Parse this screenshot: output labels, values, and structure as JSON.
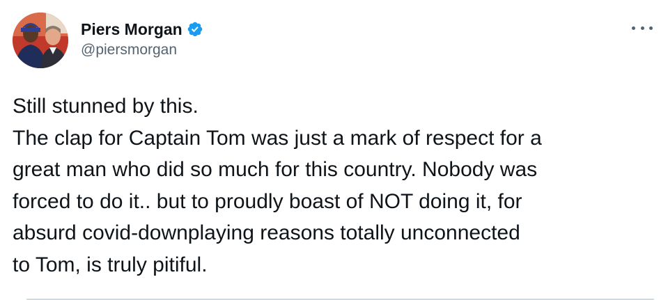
{
  "author": {
    "display_name": "Piers Morgan",
    "handle": "@piersmorgan",
    "verified": true,
    "verified_color": "#1d9bf0"
  },
  "icons": {
    "avatar": "profile-photo",
    "verified": "verified-badge-icon",
    "more": "more-options-icon"
  },
  "tweet": {
    "lines": [
      "Still stunned by this.",
      "The clap for Captain Tom was just a mark of respect for a",
      "great man who did so much for this country. Nobody was",
      "forced to do it.. but to proudly boast of NOT doing it, for",
      "absurd covid-downplaying reasons totally unconnected",
      "to Tom, is truly pitiful."
    ]
  }
}
